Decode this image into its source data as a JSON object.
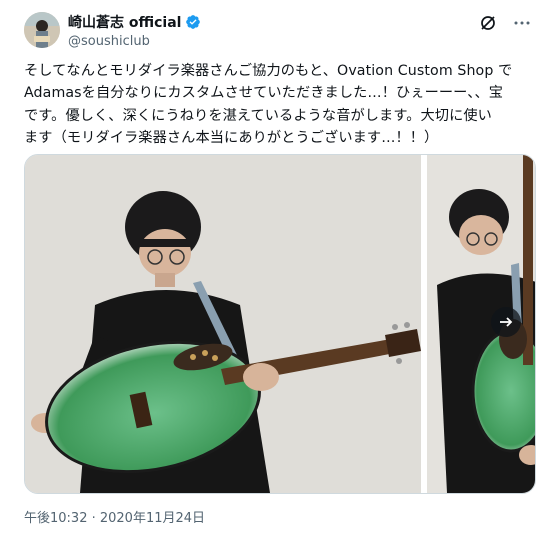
{
  "author": {
    "name": "崎山蒼志 official",
    "handle": "@soushiclub",
    "verified": true
  },
  "top_actions": {
    "grok_icon": "slash-circle-icon",
    "more_icon": "more-icon",
    "more_label": "···"
  },
  "tweet_text": "そしてなんとモリダイラ楽器さんご協力のもと、Ovation Custom Shop で\nAdamasを自分なりにカスタムさせていただきました…！ひぇーーー、、宝\nです。優しく、深くにうねりを湛えているような音がします。大切に使い\nます（モリダイラ楽器さん本当にありがとうございます…！！）",
  "media": {
    "count": 2,
    "next_icon": "arrow-right-icon"
  },
  "timestamp": "午後10:32 · 2020年11月24日",
  "colors": {
    "text": "#0f1419",
    "secondary": "#536471",
    "verified": "#1d9bf0",
    "guitar_green": "#3f9a5a"
  }
}
